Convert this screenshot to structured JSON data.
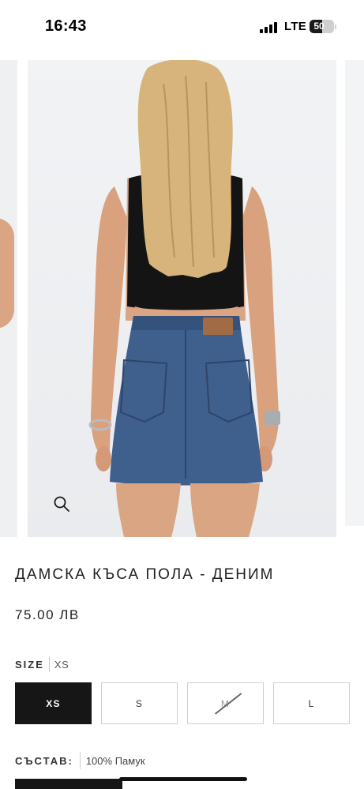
{
  "status_bar": {
    "time": "16:43",
    "network": "LTE",
    "battery": "50",
    "battery_level": 0.5,
    "signal_bars": 4
  },
  "gallery": {
    "main_image": "woman-back-view-denim-mini-skirt-black-crop-top",
    "zoom_icon": "magnifier-icon"
  },
  "product": {
    "title": "ДАМСКА КЪСА ПОЛА - ДЕНИМ",
    "price": "75.00 ЛВ"
  },
  "size": {
    "label": "SIZE",
    "selected": "XS",
    "options": [
      {
        "label": "XS",
        "state": "selected"
      },
      {
        "label": "S",
        "state": "available"
      },
      {
        "label": "M",
        "state": "unavailable"
      },
      {
        "label": "L",
        "state": "available"
      }
    ]
  },
  "composition": {
    "label": "СЪСТАВ:",
    "value": "100% Памук"
  },
  "colors": {
    "accent": "#161616",
    "border": "#cfcfcf",
    "denim": "#3f5f8d"
  }
}
